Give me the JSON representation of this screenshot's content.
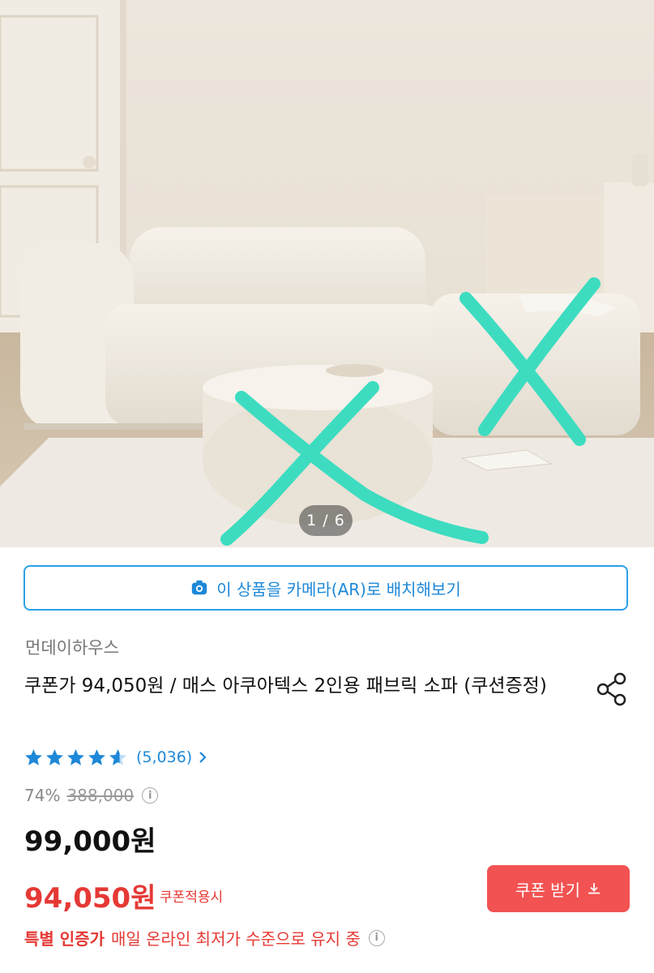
{
  "gallery": {
    "counter": "1 / 6",
    "image_description_icon": "product-photo"
  },
  "ar_button": {
    "label": "이 상품을 카메라(AR)로 배치해보기",
    "icon": "camera-icon"
  },
  "product": {
    "brand": "먼데이하우스",
    "title": "쿠폰가 94,050원 / 매스 아쿠아텍스 2인용 패브릭 소파 (쿠션증정)",
    "rating_stars": 4.5,
    "review_count": "(5,036)",
    "discount_rate": "74%",
    "original_price": "388,000",
    "price": "99,000원",
    "coupon_price": "94,050원",
    "coupon_note": "쿠폰적용시",
    "coupon_button": "쿠폰 받기",
    "lowest_price_strong": "특별 인증가",
    "lowest_price_text": "매일 온라인 최저가 수준으로 유지 중"
  },
  "colors": {
    "accent_blue": "#1e88d8",
    "sale_red": "#e53935",
    "coupon_button_bg": "#f25252",
    "markup_teal": "#3ddcc0"
  }
}
